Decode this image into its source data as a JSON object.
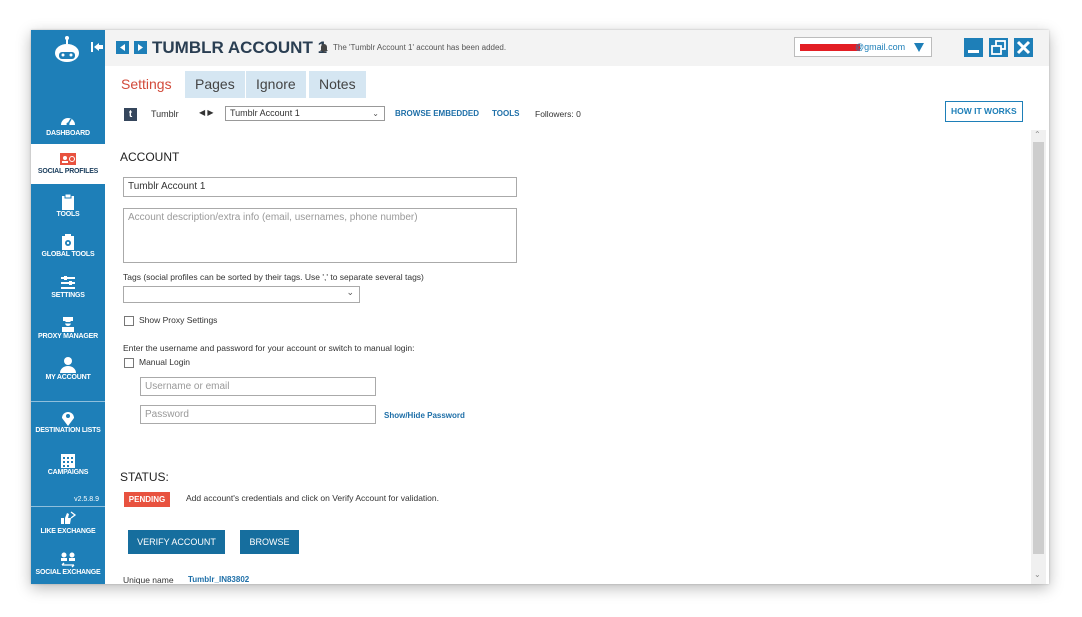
{
  "app": {
    "title": "TUMBLR ACCOUNT 1",
    "notice": "The 'Tumblr Account 1' account has been added.",
    "email_suffix": "@gmail.com",
    "version": "v2.5.8.9",
    "colors": {
      "primary": "#1e7fb8",
      "accent": "#d24a3a",
      "pending": "#e8523f",
      "button": "#166e9e"
    }
  },
  "sidebar": {
    "items": [
      {
        "label": "DASHBOARD",
        "icon": "dashboard-icon"
      },
      {
        "label": "SOCIAL PROFILES",
        "icon": "social-profiles-icon"
      },
      {
        "label": "TOOLS",
        "icon": "clipboard-icon"
      },
      {
        "label": "GLOBAL TOOLS",
        "icon": "global-tools-icon"
      },
      {
        "label": "SETTINGS",
        "icon": "settings-sliders-icon"
      },
      {
        "label": "PROXY MANAGER",
        "icon": "proxy-agent-icon"
      },
      {
        "label": "MY ACCOUNT",
        "icon": "user-icon"
      },
      {
        "label": "DESTINATION LISTS",
        "icon": "map-pin-icon"
      },
      {
        "label": "CAMPAIGNS",
        "icon": "calendar-icon"
      },
      {
        "label": "LIKE EXCHANGE",
        "icon": "like-exchange-icon"
      },
      {
        "label": "SOCIAL EXCHANGE",
        "icon": "social-exchange-icon"
      }
    ]
  },
  "tabs": [
    {
      "label": "Settings"
    },
    {
      "label": "Pages"
    },
    {
      "label": "Ignore"
    },
    {
      "label": "Notes"
    }
  ],
  "toolbar": {
    "platform": "Tumblr",
    "selected_account": "Tumblr Account 1",
    "browse_embedded": "BROWSE EMBEDDED",
    "tools": "TOOLS",
    "followers": "Followers: 0",
    "how_it_works": "HOW IT WORKS"
  },
  "form": {
    "account_heading": "ACCOUNT",
    "account_name": "Tumblr Account 1",
    "description_placeholder": "Account description/extra info (email, usernames, phone number)",
    "tags_label": "Tags (social profiles can be sorted by their tags. Use ',' to separate several tags)",
    "show_proxy": "Show Proxy Settings",
    "credentials_hint": "Enter the username and password for your account or switch to manual login:",
    "manual_login": "Manual Login",
    "username_placeholder": "Username or email",
    "password_placeholder": "Password",
    "show_hide_password": "Show/Hide Password",
    "status_heading": "STATUS:",
    "status_badge": "PENDING",
    "status_message": "Add account's credentials and click on Verify Account for validation.",
    "verify_button": "VERIFY ACCOUNT",
    "browse_button": "BROWSE",
    "unique_name_label": "Unique name",
    "unique_name_value": "Tumblr_IN83802"
  }
}
